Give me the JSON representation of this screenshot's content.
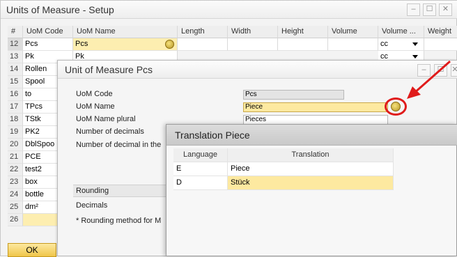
{
  "window_setup": {
    "title": "Units of Measure - Setup",
    "columns": [
      "#",
      "UoM Code",
      "UoM Name",
      "Length",
      "Width",
      "Height",
      "Volume",
      "Volume ...",
      "Weight"
    ],
    "rows": [
      {
        "num": "12",
        "code": "Pcs",
        "name": "Pcs",
        "volume_unit": "cc"
      },
      {
        "num": "13",
        "code": "Pk",
        "name": "Pk",
        "volume_unit": "cc"
      },
      {
        "num": "14",
        "code": "Rollen",
        "name": "",
        "volume_unit": ""
      },
      {
        "num": "15",
        "code": "Spool",
        "name": "",
        "volume_unit": ""
      },
      {
        "num": "16",
        "code": "to",
        "name": "",
        "volume_unit": ""
      },
      {
        "num": "17",
        "code": "TPcs",
        "name": "",
        "volume_unit": ""
      },
      {
        "num": "18",
        "code": "TStk",
        "name": "",
        "volume_unit": ""
      },
      {
        "num": "19",
        "code": "PK2",
        "name": "",
        "volume_unit": ""
      },
      {
        "num": "20",
        "code": "DblSpoo",
        "name": "",
        "volume_unit": ""
      },
      {
        "num": "21",
        "code": "PCE",
        "name": "",
        "volume_unit": ""
      },
      {
        "num": "22",
        "code": "test2",
        "name": "",
        "volume_unit": ""
      },
      {
        "num": "23",
        "code": "box",
        "name": "",
        "volume_unit": ""
      },
      {
        "num": "24",
        "code": "bottle",
        "name": "",
        "volume_unit": ""
      },
      {
        "num": "25",
        "code": "dm²",
        "name": "",
        "volume_unit": ""
      },
      {
        "num": "26",
        "code": "",
        "name": "",
        "volume_unit": ""
      }
    ],
    "ok_label": "OK"
  },
  "window_uom": {
    "title": "Unit of Measure Pcs",
    "uom_code_label": "UoM Code",
    "uom_code_value": "Pcs",
    "uom_name_label": "UoM Name",
    "uom_name_value": "Piece",
    "uom_name_plural_label": "UoM Name plural",
    "uom_name_plural_value": "Pieces",
    "num_decimals_label": "Number of decimals",
    "num_decimal_in_label": "Number of decimal in the",
    "rounding_label": "Rounding",
    "decimals_label": "Decimals",
    "rounding_note": "* Rounding method for M"
  },
  "window_translation": {
    "title": "Translation Piece",
    "columns": [
      "Language",
      "Translation"
    ],
    "rows": [
      {
        "language": "E",
        "translation": "Piece"
      },
      {
        "language": "D",
        "translation": "Stück"
      }
    ]
  },
  "colors": {
    "highlight_yellow": "#fde9a0",
    "annotation_red": "#e01b1b",
    "ok_button": "#f0c64a"
  }
}
